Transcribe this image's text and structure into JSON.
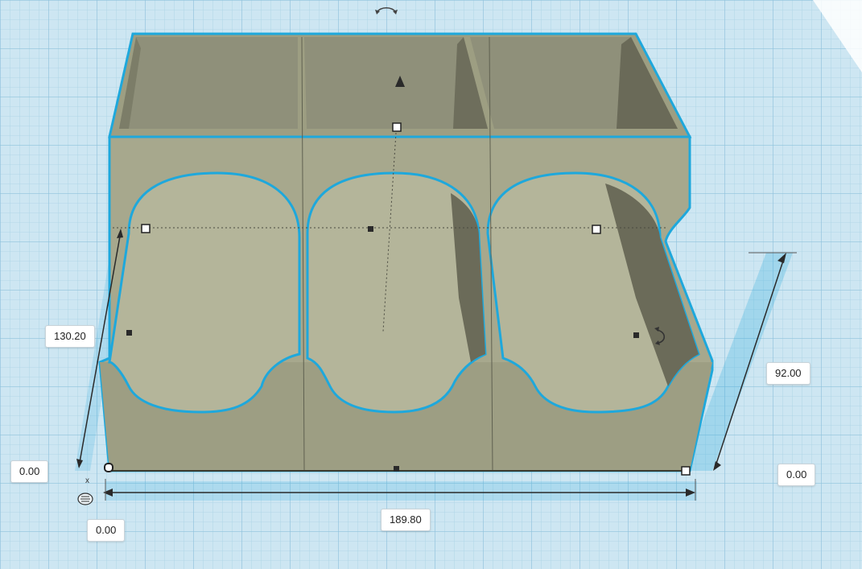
{
  "dimensions": {
    "height": "130.20",
    "width": "189.80",
    "depth": "92.00",
    "origin_left": "0.00",
    "origin_right": "0.00",
    "origin_bottom": "0.00"
  },
  "axis_marker": "x",
  "colors": {
    "workplane": "#cde6f2",
    "grid_line": "#9fcbe0",
    "shape_fill": "#a5a68a",
    "shape_dark": "#6c6c5c",
    "selection_outline": "#1eaadc",
    "dimension_arrow": "#2a2a2a"
  },
  "icons": {
    "rotate_top": "rotate-arrow-icon",
    "rotate_side": "rotate-arrow-icon",
    "lift_cone": "cone-lift-icon",
    "snap_grid": "snap-grid-icon"
  }
}
